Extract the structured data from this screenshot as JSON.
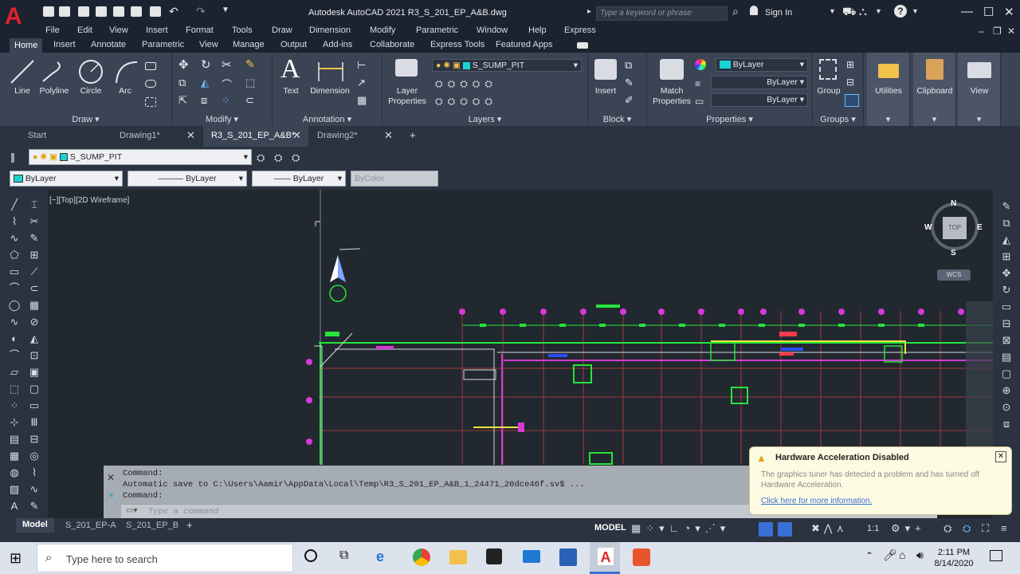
{
  "title": "Autodesk AutoCAD 2021    R3_S_201_EP_A&B.dwg",
  "search": {
    "placeholder": "Type a keyword or phrase"
  },
  "account": {
    "sign_in": "Sign In"
  },
  "menubar": [
    "File",
    "Edit",
    "View",
    "Insert",
    "Format",
    "Tools",
    "Draw",
    "Dimension",
    "Modify",
    "Parametric",
    "Window",
    "Help",
    "Express"
  ],
  "ribbon_tabs": [
    "Home",
    "Insert",
    "Annotate",
    "Parametric",
    "View",
    "Manage",
    "Output",
    "Add-ins",
    "Collaborate",
    "Express Tools",
    "Featured Apps"
  ],
  "ribbon": {
    "draw": {
      "title": "Draw",
      "line": "Line",
      "polyline": "Polyline",
      "circle": "Circle",
      "arc": "Arc"
    },
    "modify": {
      "title": "Modify"
    },
    "annotation": {
      "title": "Annotation",
      "text": "Text",
      "dimension": "Dimension"
    },
    "layers": {
      "title": "Layers",
      "layer_properties_1": "Layer",
      "layer_properties_2": "Properties",
      "current_layer": "S_SUMP_PIT"
    },
    "block": {
      "title": "Block",
      "insert": "Insert"
    },
    "properties": {
      "title": "Properties",
      "match_1": "Match",
      "match_2": "Properties",
      "color": "ByLayer",
      "linetype": "ByLayer",
      "lineweight": "ByLayer"
    },
    "groups": {
      "title": "Groups",
      "group": "Group"
    },
    "utilities": {
      "label": "Utilities"
    },
    "clipboard": {
      "label": "Clipboard"
    },
    "view": {
      "label": "View"
    }
  },
  "doc_tabs": [
    "Start",
    "Drawing1*",
    "R3_S_201_EP_A&B*",
    "Drawing2*"
  ],
  "props": {
    "layer": "S_SUMP_PIT",
    "color": "ByLayer",
    "linetype": "ByLayer",
    "lineweight": "ByLayer",
    "plotstyle": "ByColor"
  },
  "viewport_label": "[−][Top][2D Wireframe]",
  "viewcube": {
    "n": "N",
    "s": "S",
    "e": "E",
    "w": "W",
    "top": "TOP",
    "wcs": "WCS"
  },
  "command": {
    "line1": "Command:",
    "line2": "Automatic save to C:\\Users\\Aamir\\AppData\\Local\\Temp\\R3_S_201_EP_A&B_1_24471_20dce46f.sv$ ...",
    "line3": "Command:",
    "placeholder": "Type a command"
  },
  "popup": {
    "title": "Hardware Acceleration Disabled",
    "body": "The graphics tuner has detected a problem and has turned off Hardware Acceleration.",
    "link": "Click here for more information."
  },
  "layout_tabs": [
    "Model",
    "S_201_EP-A",
    "S_201_EP_B"
  ],
  "status": {
    "model": "MODEL",
    "scale": "1:1"
  },
  "taskbar": {
    "search": "Type here to search",
    "time": "2:11 PM",
    "date": "8/14/2020"
  },
  "colors": {
    "accent": "#e0232b",
    "canvas": "#212830",
    "ribbon": "#3b4455",
    "green": "#27e33a",
    "magenta": "#d63ad6"
  }
}
